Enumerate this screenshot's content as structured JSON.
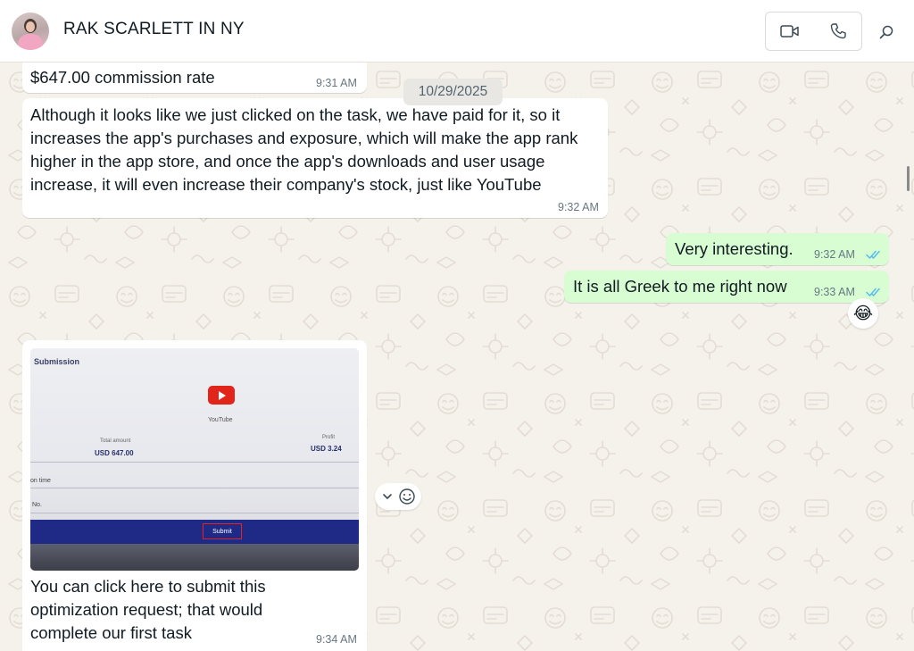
{
  "header": {
    "contact_name": "RAK SCARLETT IN NY",
    "icons": [
      "video-call-icon",
      "voice-call-icon",
      "search-icon"
    ]
  },
  "chat": {
    "date_separator": "10/29/2025",
    "messages": [
      {
        "direction": "in",
        "text": "$647.00 commission rate",
        "time": "9:31 AM"
      },
      {
        "direction": "in",
        "text": "Although it looks like we just clicked on the task, we have paid for it, so it increases the app's purchases and exposure, which will make the app rank higher in the app store, and once the app's downloads and user usage increase, it will even increase their company's stock, just like YouTube",
        "time": "9:32 AM"
      },
      {
        "direction": "out",
        "text": "Very interesting.",
        "time": "9:32 AM",
        "status": "read"
      },
      {
        "direction": "out",
        "text": "It is all Greek to me right now",
        "time": "9:33 AM",
        "status": "read",
        "reaction": "😂"
      },
      {
        "direction": "in",
        "text": "You can click here to submit this optimization request; that would complete our first task",
        "time": "9:34 AM",
        "has_image": true
      }
    ],
    "image": {
      "submission": "Submission",
      "app": "YouTube",
      "total_label": "Total amount",
      "total_value": "USD 647.00",
      "profit_label": "Profit",
      "profit_value": "USD 3.24",
      "row1": "on time",
      "row2": "No.",
      "submit": "Submit"
    }
  },
  "colors": {
    "background": "#f5f1eb",
    "outgoing_bubble": "#d9fdd3",
    "incoming_bubble": "#ffffff",
    "read_ticks": "#53bdeb"
  }
}
